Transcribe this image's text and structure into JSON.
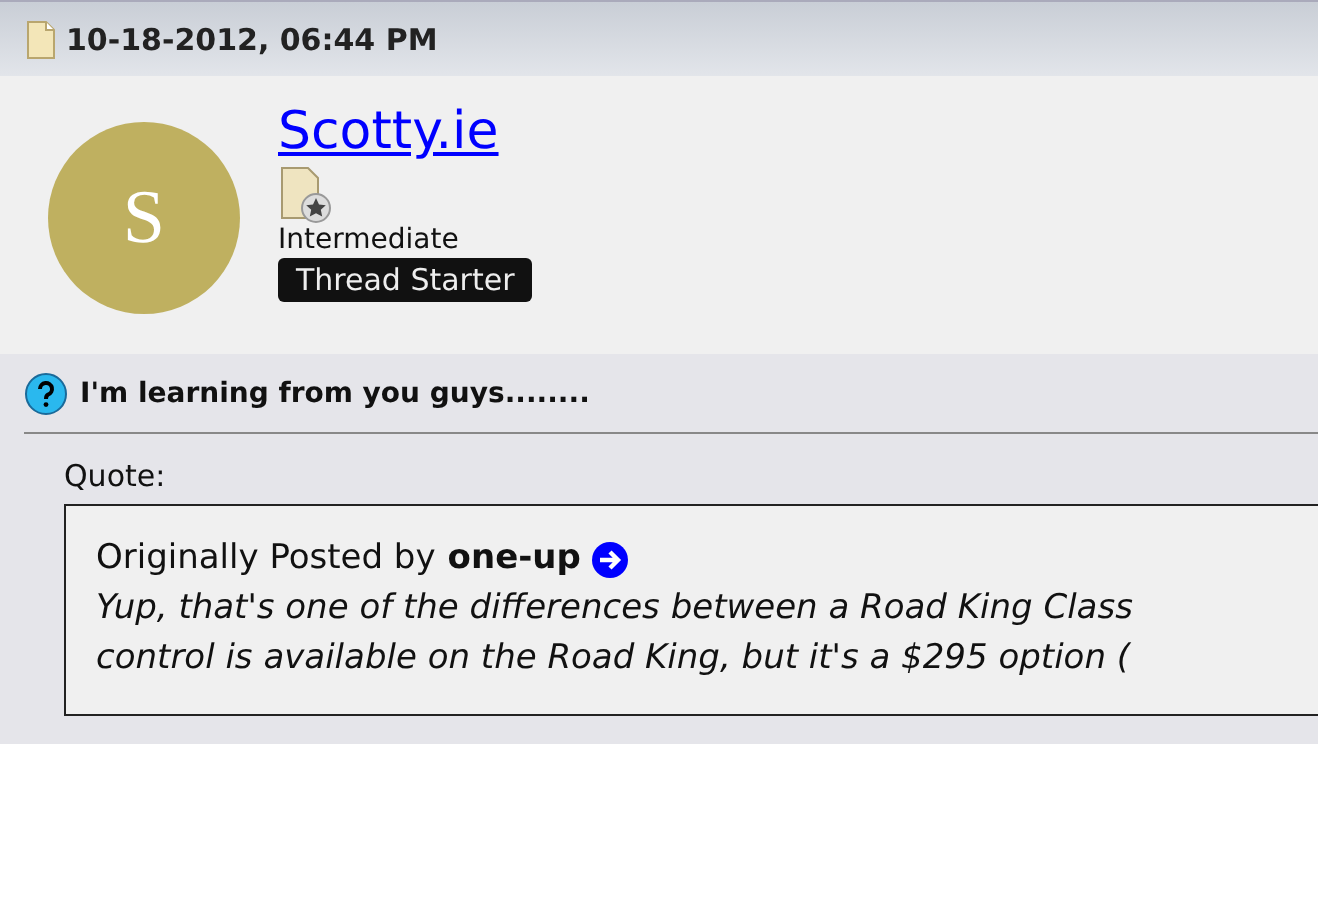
{
  "post": {
    "date": "10-18-2012, 06:44 PM",
    "user": {
      "avatar_letter": "S",
      "name": "Scotty.ie",
      "rank": "Intermediate",
      "badge": "Thread Starter"
    },
    "title": "I'm learning from you guys........",
    "quote": {
      "label": "Quote:",
      "prefix": "Originally Posted by",
      "author": "one-up",
      "lines": [
        "Yup, that's one of the differences between a Road King Class",
        "control is available on the Road King, but it's a $295 option ("
      ]
    }
  }
}
